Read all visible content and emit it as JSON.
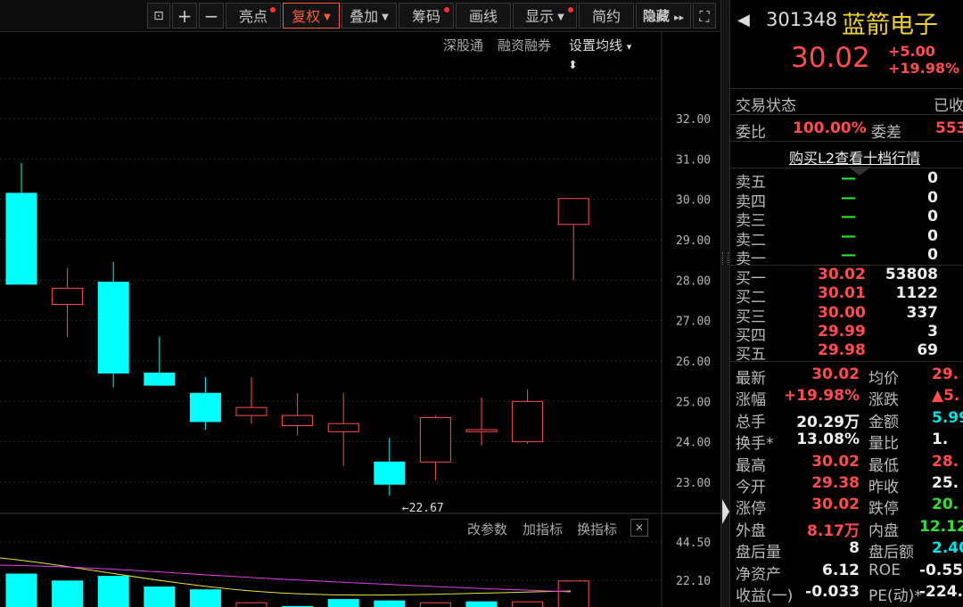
{
  "toolbar": {
    "unlock": "⊡",
    "plus": "+",
    "minus": "−",
    "highlight": "亮点",
    "fuquan": "复权",
    "overlay": "叠加",
    "chips": "筹码",
    "draw": "画线",
    "display": "显示",
    "simple": "简约",
    "hide": "隐藏",
    "hide_arrows": "▸▸",
    "fullscreen": "⛶"
  },
  "subtools": {
    "sgt": "深股通",
    "margin": "融资融券",
    "ma_settings": "设置均线",
    "ma_caret": "▾",
    "updown": "⬍"
  },
  "indicator_toolbar": {
    "params": "改参数",
    "add": "加指标",
    "switch": "换指标",
    "close": "✕"
  },
  "chart_data": {
    "type": "candlestick",
    "y_ticks": [
      "32.00",
      "31.00",
      "30.00",
      "29.00",
      "28.00",
      "27.00",
      "26.00",
      "25.00",
      "24.00",
      "23.00"
    ],
    "y_ticks_values": [
      32,
      31,
      30,
      29,
      28,
      27,
      26,
      25,
      24,
      23
    ],
    "candles": [
      {
        "o": 30.15,
        "c": 27.9,
        "h": 30.9,
        "l": 27.9
      },
      {
        "o": 27.4,
        "c": 27.8,
        "h": 28.3,
        "l": 26.6
      },
      {
        "o": 27.95,
        "c": 25.7,
        "h": 28.45,
        "l": 25.35
      },
      {
        "o": 25.7,
        "c": 25.4,
        "h": 26.6,
        "l": 25.4
      },
      {
        "o": 25.2,
        "c": 24.5,
        "h": 25.6,
        "l": 24.3
      },
      {
        "o": 24.65,
        "c": 24.85,
        "h": 25.6,
        "l": 24.45
      },
      {
        "o": 24.4,
        "c": 24.65,
        "h": 25.2,
        "l": 24.15
      },
      {
        "o": 24.25,
        "c": 24.45,
        "h": 25.2,
        "l": 23.4
      },
      {
        "o": 23.5,
        "c": 22.95,
        "h": 24.1,
        "l": 22.67
      },
      {
        "o": 23.5,
        "c": 24.6,
        "h": 24.65,
        "l": 23.05
      },
      {
        "o": 24.25,
        "c": 24.3,
        "h": 25.1,
        "l": 23.9
      },
      {
        "o": 24.0,
        "c": 25.0,
        "h": 25.3,
        "l": 23.95
      },
      {
        "o": 29.38,
        "c": 30.02,
        "h": 30.02,
        "l": 28.0
      }
    ],
    "low_annotation": "←22.67",
    "volume": {
      "y_ticks": [
        "44.50",
        "22.10"
      ],
      "bars": [
        {
          "v": 1.0,
          "up": false
        },
        {
          "v": 0.85,
          "up": false
        },
        {
          "v": 0.95,
          "up": false
        },
        {
          "v": 0.72,
          "up": false
        },
        {
          "v": 0.66,
          "up": false
        },
        {
          "v": 0.38,
          "up": true
        },
        {
          "v": 0.3,
          "up": false
        },
        {
          "v": 0.45,
          "up": false
        },
        {
          "v": 0.42,
          "up": false
        },
        {
          "v": 0.38,
          "up": true
        },
        {
          "v": 0.4,
          "up": false
        },
        {
          "v": 0.4,
          "up": true
        },
        {
          "v": 0.85,
          "up": true
        }
      ]
    }
  },
  "quote": {
    "arrow": "◀",
    "code": "301348",
    "name": "蓝箭电子",
    "price": "30.02",
    "change": "+5.00",
    "change_pct": "+19.98%",
    "trade_status_label": "交易状态",
    "trade_status": "已收",
    "weibi_label": "委比",
    "weibi": "100.00%",
    "weicha_label": "委差",
    "weicha": "553",
    "l2": "购买L2查看十档行情",
    "asks": [
      {
        "label": "卖五",
        "price": "—",
        "vol": "0"
      },
      {
        "label": "卖四",
        "price": "—",
        "vol": "0"
      },
      {
        "label": "卖三",
        "price": "—",
        "vol": "0"
      },
      {
        "label": "卖二",
        "price": "—",
        "vol": "0"
      },
      {
        "label": "卖一",
        "price": "—",
        "vol": "0"
      }
    ],
    "bids": [
      {
        "label": "买一",
        "price": "30.02",
        "vol": "53808"
      },
      {
        "label": "买二",
        "price": "30.01",
        "vol": "1122"
      },
      {
        "label": "买三",
        "price": "30.00",
        "vol": "337"
      },
      {
        "label": "买四",
        "price": "29.99",
        "vol": "3"
      },
      {
        "label": "买五",
        "price": "29.98",
        "vol": "69"
      }
    ],
    "stats": [
      {
        "l1": "最新",
        "v1": "30.02",
        "c1": "red",
        "l2": "均价",
        "v2": "29.",
        "c2": "red"
      },
      {
        "l1": "涨幅",
        "v1": "+19.98%",
        "c1": "red",
        "l2": "涨跌",
        "v2": "▲5.",
        "c2": "red"
      },
      {
        "l1": "总手",
        "v1": "20.29万",
        "c1": "wht",
        "l2": "金额",
        "v2": "5.99",
        "c2": "cyan"
      },
      {
        "l1": "换手*",
        "v1": "13.08%",
        "c1": "wht",
        "l2": "量比",
        "v2": "1.",
        "c2": "wht"
      },
      {
        "l1": "最高",
        "v1": "30.02",
        "c1": "red",
        "l2": "最低",
        "v2": "28.",
        "c2": "red"
      },
      {
        "l1": "今开",
        "v1": "29.38",
        "c1": "red",
        "l2": "昨收",
        "v2": "25.",
        "c2": "wht"
      },
      {
        "l1": "涨停",
        "v1": "30.02",
        "c1": "red",
        "l2": "跌停",
        "v2": "20.",
        "c2": "grn"
      },
      {
        "l1": "外盘",
        "v1": "8.17万",
        "c1": "red",
        "l2": "内盘",
        "v2": "12.12",
        "c2": "grn"
      },
      {
        "l1": "盘后量",
        "v1": "8",
        "c1": "wht",
        "l2": "盘后额",
        "v2": "2.40",
        "c2": "cyan"
      },
      {
        "l1": "净资产",
        "v1": "6.12",
        "c1": "wht",
        "l2": "ROE",
        "v2": "-0.55",
        "c2": "wht"
      },
      {
        "l1": "收益(一)",
        "v1": "-0.033",
        "c1": "wht",
        "l2": "PE(动)*",
        "v2": "-224.",
        "c2": "wht"
      }
    ]
  },
  "colors": {
    "up": "#ff4d4d",
    "down": "#00ffff",
    "ma_yellow": "#e6e62e",
    "ma_purple": "#e040e0"
  }
}
